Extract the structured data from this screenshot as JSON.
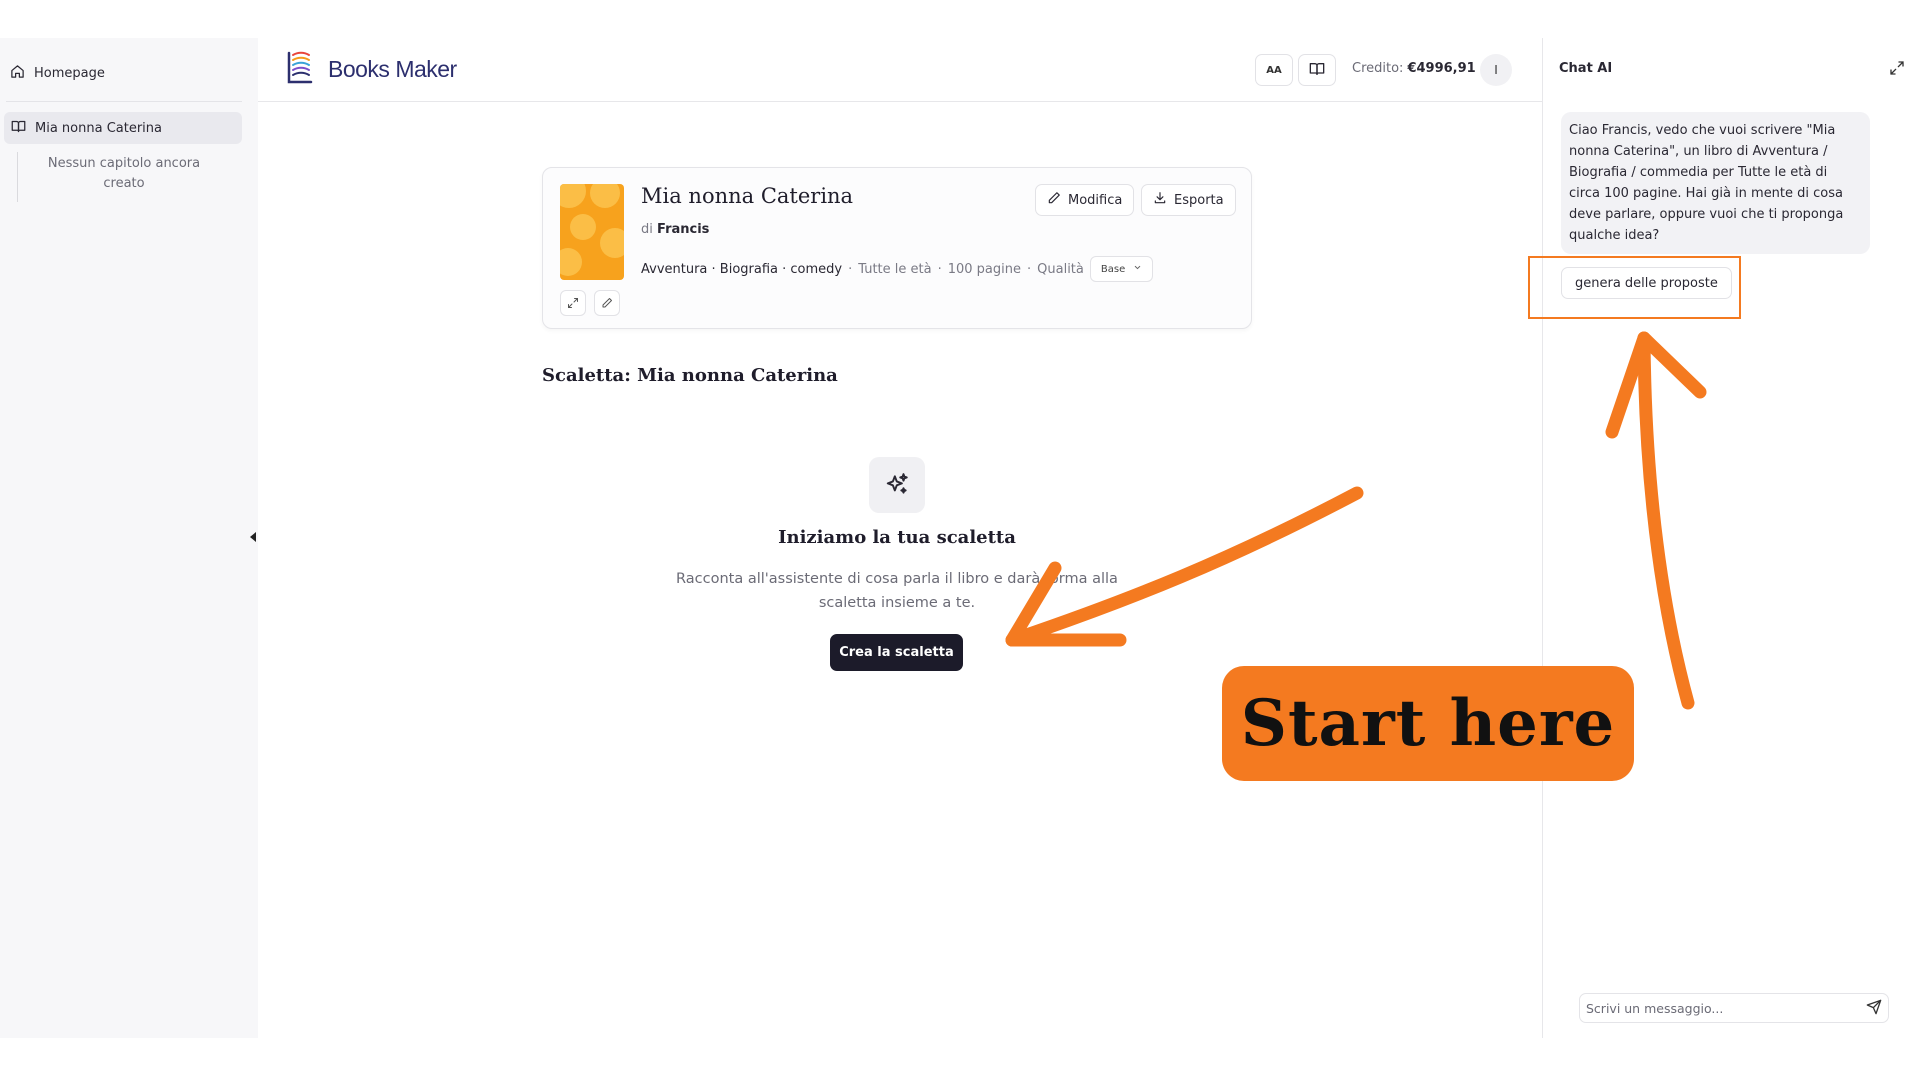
{
  "sidebar": {
    "home_label": "Homepage",
    "book_label": "Mia nonna Caterina",
    "empty_chapters": "Nessun capitolo ancora creato"
  },
  "header": {
    "logo_text": "Books Maker",
    "font_button_label": "AA",
    "credit_label": "Credito:",
    "credit_value": "€4996,91",
    "avatar_initial": "I"
  },
  "book": {
    "title": "Mia nonna Caterina",
    "author_prefix": "di",
    "author": "Francis",
    "genres": "Avventura · Biografia · comedy",
    "age": "Tutte le età",
    "pages": "100 pagine",
    "quality_label": "Qualità",
    "quality_value": "Base",
    "edit_label": "Modifica",
    "export_label": "Esporta",
    "cover_color": "#f7a21d"
  },
  "outline": {
    "title": "Scaletta: Mia nonna Caterina",
    "empty_title": "Iniziamo la tua scaletta",
    "empty_desc": "Racconta all'assistente di cosa parla il libro e darà forma alla scaletta insieme a te.",
    "cta_label": "Crea la scaletta"
  },
  "chat": {
    "title": "Chat AI",
    "message": "Ciao Francis, vedo che vuoi scrivere \"Mia nonna Caterina\", un libro di Avventura / Biografia / commedia per Tutte le età di circa 100 pagine. Hai già in mente di cosa deve parlare, oppure vuoi che ti proponga qualche idea?",
    "suggestion": "genera delle proposte",
    "input_placeholder": "Scrivi un messaggio..."
  },
  "annotation": {
    "callout_text": "Start here",
    "accent_color": "#f47a20"
  }
}
